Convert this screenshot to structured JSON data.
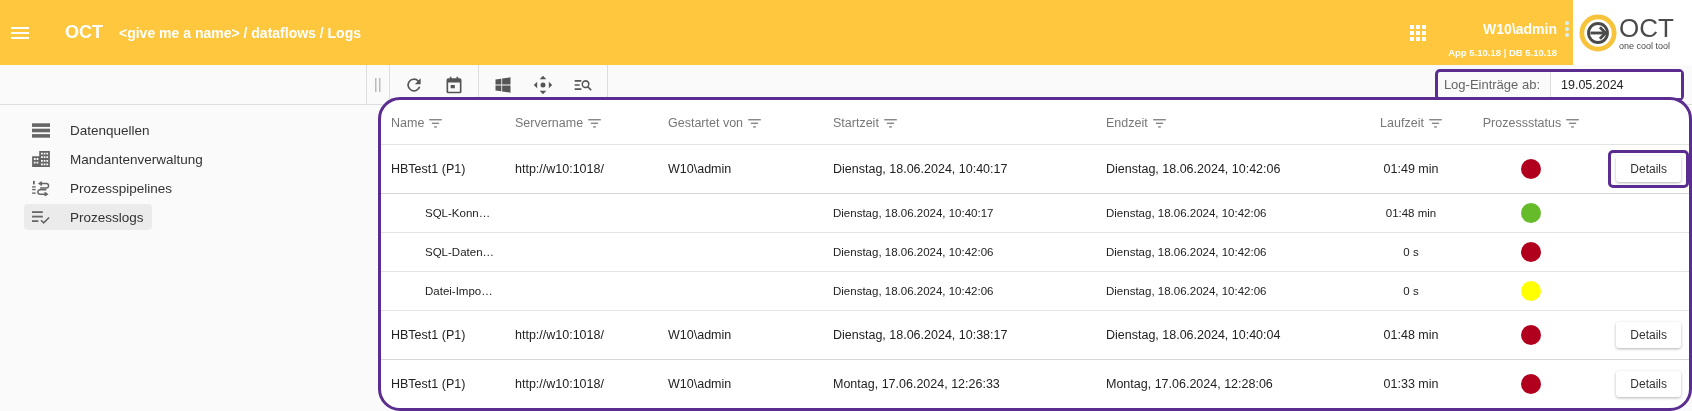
{
  "header": {
    "app_name": "OCT",
    "breadcrumb": "<give me a name> / dataflows / Logs",
    "user": "W10\\admin",
    "version": "App 5.10.18 | DB 5.10.18",
    "logo_text": "OCT",
    "logo_tagline": "one cool tool"
  },
  "filter": {
    "label": "Log-Einträge ab:",
    "value": "19.05.2024",
    "highlighted": true
  },
  "sidebar": {
    "items": [
      {
        "label": "Datenquellen",
        "selected": false
      },
      {
        "label": "Mandantenverwaltung",
        "selected": false
      },
      {
        "label": "Prozesspipelines",
        "selected": false
      },
      {
        "label": "Prozesslogs",
        "selected": true
      }
    ]
  },
  "table": {
    "highlighted": true,
    "columns": [
      "Name",
      "Servername",
      "Gestartet von",
      "Startzeit",
      "Endzeit",
      "Laufzeit",
      "Prozessstatus"
    ],
    "rows": [
      {
        "name": "HBTest1 (P1)",
        "server": "http://w10:1018/",
        "started_by": "W10\\admin",
        "start": "Dienstag, 18.06.2024, 10:40:17",
        "end": "Dienstag, 18.06.2024, 10:42:06",
        "duration": "01:49 min",
        "color": "#b0001e",
        "details": "Details",
        "details_highlighted": true,
        "children": [
          {
            "name": "SQL-Konn…",
            "start": "Dienstag, 18.06.2024, 10:40:17",
            "end": "Dienstag, 18.06.2024, 10:42:06",
            "duration": "01:48 min",
            "color": "#66bb2a"
          },
          {
            "name": "SQL-Daten…",
            "start": "Dienstag, 18.06.2024, 10:42:06",
            "end": "Dienstag, 18.06.2024, 10:42:06",
            "duration": "0 s",
            "color": "#b0001e"
          },
          {
            "name": "Datei-Impo…",
            "start": "Dienstag, 18.06.2024, 10:42:06",
            "end": "Dienstag, 18.06.2024, 10:42:06",
            "duration": "0 s",
            "color": "#ffff00"
          }
        ]
      },
      {
        "name": "HBTest1 (P1)",
        "server": "http://w10:1018/",
        "started_by": "W10\\admin",
        "start": "Dienstag, 18.06.2024, 10:38:17",
        "end": "Dienstag, 18.06.2024, 10:40:04",
        "duration": "01:48 min",
        "color": "#b0001e",
        "details": "Details",
        "details_highlighted": false
      },
      {
        "name": "HBTest1 (P1)",
        "server": "http://w10:1018/",
        "started_by": "W10\\admin",
        "start": "Montag, 17.06.2024, 12:26:33",
        "end": "Montag, 17.06.2024, 12:28:06",
        "duration": "01:33 min",
        "color": "#b0001e",
        "details": "Details",
        "details_highlighted": false
      }
    ]
  }
}
